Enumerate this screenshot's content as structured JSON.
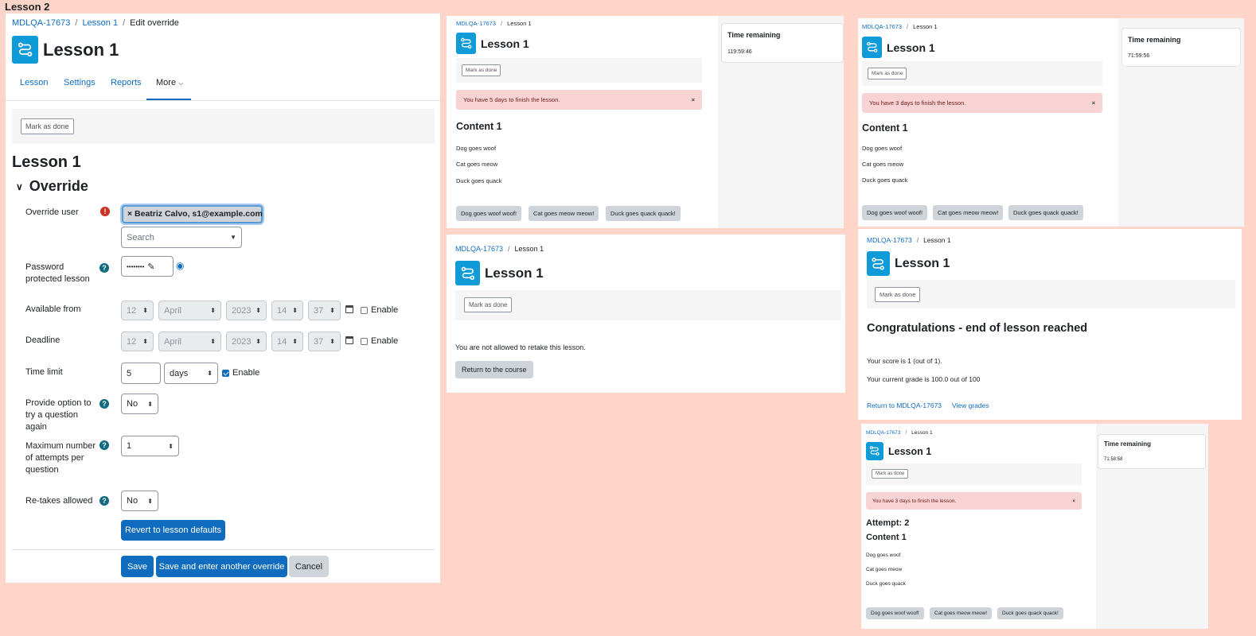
{
  "page_title": "Lesson 2",
  "main": {
    "breadcrumb": [
      "MDLQA-17673",
      "Lesson 1",
      "Edit override"
    ],
    "title": "Lesson 1",
    "tabs": [
      "Lesson",
      "Settings",
      "Reports",
      "More"
    ],
    "mark_done": "Mark as done",
    "section_title": "Lesson 1",
    "override_heading": "Override",
    "form": {
      "override_user_label": "Override user",
      "override_user_value": "× Beatriz Calvo, s1@example.com",
      "search_placeholder": "Search",
      "password_label": "Password protected lesson",
      "password_value": "••••••••",
      "available_label": "Available from",
      "deadline_label": "Deadline",
      "date_day": "12",
      "date_month": "April",
      "date_year": "2023",
      "date_hour": "14",
      "date_min": "37",
      "enable": "Enable",
      "time_limit_label": "Time limit",
      "time_limit_value": "5",
      "time_limit_unit": "days",
      "try_again_label": "Provide option to try a question again",
      "try_again_value": "No",
      "max_attempts_label": "Maximum number of attempts per question",
      "max_attempts_value": "1",
      "retakes_label": "Re-takes allowed",
      "retakes_value": "No",
      "revert": "Revert to lesson defaults",
      "save": "Save",
      "save_another": "Save and enter another override",
      "cancel": "Cancel"
    }
  },
  "s1": {
    "crumb": [
      "MDLQA-17673",
      "Lesson 1"
    ],
    "title": "Lesson 1",
    "mark": "Mark as done",
    "alert": "You have 5 days to finish the lesson.",
    "content": "Content 1",
    "lines": [
      "Dog goes woof",
      "Cat goes meow",
      "Duck goes quack"
    ],
    "btns": [
      "Dog goes woof woof!",
      "Cat goes meow meow!",
      "Duck goes quack quack!"
    ],
    "time_title": "Time remaining",
    "time": "119:59:46"
  },
  "s2": {
    "crumb": [
      "MDLQA-17673",
      "Lesson 1"
    ],
    "title": "Lesson 1",
    "mark": "Mark as done",
    "alert": "You have 3 days to finish the lesson.",
    "content": "Content 1",
    "lines": [
      "Dog goes woof",
      "Cat goes meow",
      "Duck goes quack"
    ],
    "btns": [
      "Dog goes woof woof!",
      "Cat goes meow meow!",
      "Duck goes quack quack!"
    ],
    "time_title": "Time remaining",
    "time": "71:59:56"
  },
  "s3": {
    "crumb": [
      "MDLQA-17673",
      "Lesson 1"
    ],
    "title": "Lesson 1",
    "mark": "Mark as done",
    "msg": "You are not allowed to retake this lesson.",
    "btn": "Return to the course"
  },
  "s4": {
    "crumb": [
      "MDLQA-17673",
      "Lesson 1"
    ],
    "title": "Lesson 1",
    "mark": "Mark as done",
    "heading": "Congratulations - end of lesson reached",
    "score": "Your score is 1 (out of 1).",
    "grade": "Your current grade is 100.0 out of 100",
    "return": "Return to MDLQA-17673",
    "grades": "View grades"
  },
  "s5": {
    "crumb": [
      "MDLQA-17673",
      "Lesson 1"
    ],
    "title": "Lesson 1",
    "mark": "Mark as done",
    "alert": "You have 3 days to finish the lesson.",
    "attempt": "Attempt: 2",
    "content": "Content 1",
    "lines": [
      "Dog goes woof",
      "Cat goes meow",
      "Duck goes quack"
    ],
    "btns": [
      "Dog goes woof woof!",
      "Cat goes meow meow!",
      "Duck goes quack quack!"
    ],
    "time_title": "Time remaining",
    "time": "71:58:58"
  }
}
